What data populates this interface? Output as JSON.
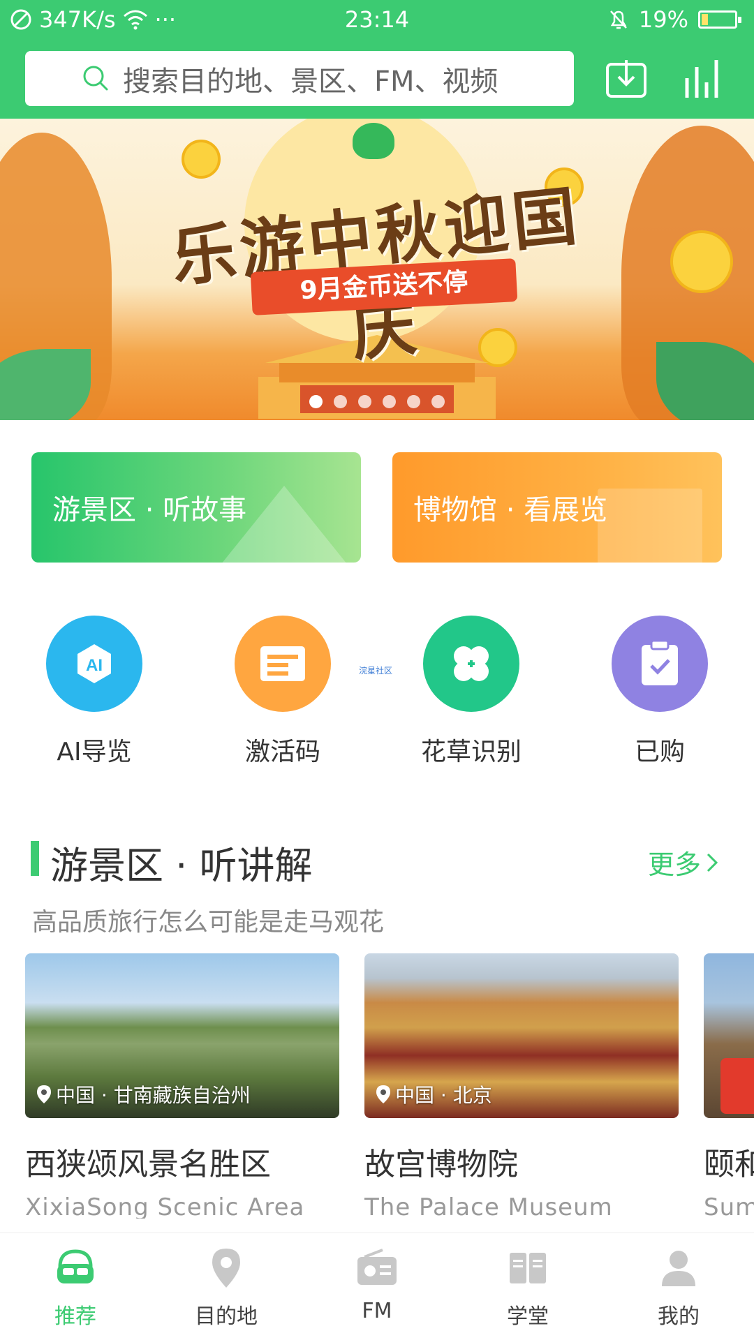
{
  "status": {
    "speed": "347K/s",
    "time": "23:14",
    "battery": "19%",
    "battery_level": 0.19,
    "dots": "···"
  },
  "search": {
    "placeholder": "搜索目的地、景区、FM、视频"
  },
  "header_icons": [
    "download-icon",
    "chart-icon"
  ],
  "banner": {
    "title": "乐游中秋迎国庆",
    "ribbon": "9月金币送不停",
    "slide_count": 6,
    "active_slide": 1
  },
  "cards": [
    {
      "label": "游景区 · 听故事",
      "color": "#2bc66c"
    },
    {
      "label": "博物馆 · 看展览",
      "color": "#ffa233"
    }
  ],
  "quick": [
    {
      "label": "AI导览",
      "icon": "ai-icon",
      "color": "#2bb7ee"
    },
    {
      "label": "激活码",
      "icon": "code-card-icon",
      "color": "#ffa640"
    },
    {
      "label": "花草识别",
      "icon": "clover-icon",
      "color": "#22c789"
    },
    {
      "label": "已购",
      "icon": "clipboard-check-icon",
      "color": "#8f82e2"
    }
  ],
  "watermark": "浣星社区",
  "section": {
    "title": "游景区 · 听讲解",
    "more": "更多",
    "subtitle": "高品质旅行怎么可能是走马观花"
  },
  "places": [
    {
      "location": "中国 · 甘南藏族自治州",
      "name": "西狭颂风景名胜区",
      "en": "XixiaSong Scenic Area"
    },
    {
      "location": "中国 · 北京",
      "name": "故宫博物院",
      "en": "The Palace Museum"
    },
    {
      "location": "",
      "name": "颐和",
      "en": "Sum"
    }
  ],
  "tabs": [
    {
      "label": "推荐",
      "icon": "vr-headset-icon"
    },
    {
      "label": "目的地",
      "icon": "location-pin-icon"
    },
    {
      "label": "FM",
      "icon": "radio-icon"
    },
    {
      "label": "学堂",
      "icon": "book-icon"
    },
    {
      "label": "我的",
      "icon": "person-icon"
    }
  ],
  "colors": {
    "brand": "#3ccb72",
    "accent_orange": "#ff9a2b"
  }
}
